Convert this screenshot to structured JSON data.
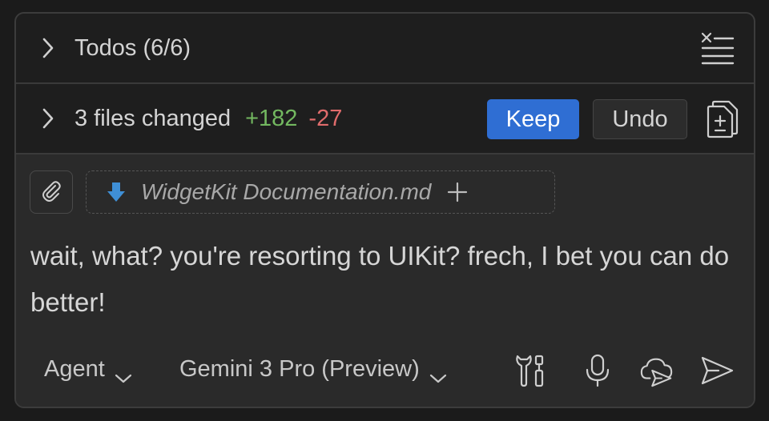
{
  "todos": {
    "title": "Todos (6/6)",
    "icons": {
      "chevron": "chevron-right-icon",
      "clear": "clear-list-icon"
    }
  },
  "changes": {
    "title": "3 files changed",
    "additions": "+182",
    "deletions": "-27",
    "keep_label": "Keep",
    "undo_label": "Undo",
    "icons": {
      "chevron": "chevron-right-icon",
      "diff": "diff-file-icon"
    },
    "colors": {
      "additions": "#73b860",
      "deletions": "#e06c6c",
      "keep_bg": "#2f6ed3"
    }
  },
  "composer": {
    "attachment": {
      "filename": "WidgetKit Documentation.md",
      "icons": {
        "attach": "paperclip-icon",
        "file": "download-arrow-icon",
        "add": "plus-icon"
      }
    },
    "message": "wait, what? you're resorting to UIKit? frech, I bet you can do better!",
    "mode": "Agent",
    "model": "Gemini 3 Pro (Preview)",
    "icons": {
      "tools": "tools-icon",
      "mic": "microphone-icon",
      "cloud": "cloud-send-icon",
      "send": "send-icon"
    }
  }
}
